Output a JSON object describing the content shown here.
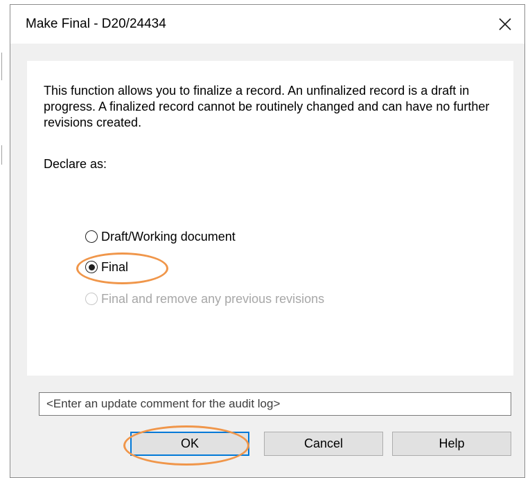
{
  "dialog": {
    "title": "Make Final - D20/24434",
    "close_glyph": "✕",
    "close_icon": "close-icon"
  },
  "content": {
    "description": "This function allows you to finalize a record.  An unfinalized record is a draft in progress.  A finalized record cannot be routinely changed and can have no further revisions created.",
    "declare_label": "Declare as:",
    "options": [
      {
        "label": "Draft/Working document",
        "selected": false,
        "enabled": true
      },
      {
        "label": "Final",
        "selected": true,
        "enabled": true
      },
      {
        "label": "Final and remove any previous revisions",
        "selected": false,
        "enabled": false
      }
    ]
  },
  "comment": {
    "value": "",
    "placeholder": "<Enter an update comment for the audit log>"
  },
  "buttons": {
    "ok_label": "OK",
    "cancel_label": "Cancel",
    "help_label": "Help"
  },
  "colors": {
    "dialog_background": "#f0f0f0",
    "content_background": "#ffffff",
    "highlight_annotation": "#f0964a",
    "default_button_border": "#0078d7",
    "disabled_text": "#a7a7a7"
  }
}
